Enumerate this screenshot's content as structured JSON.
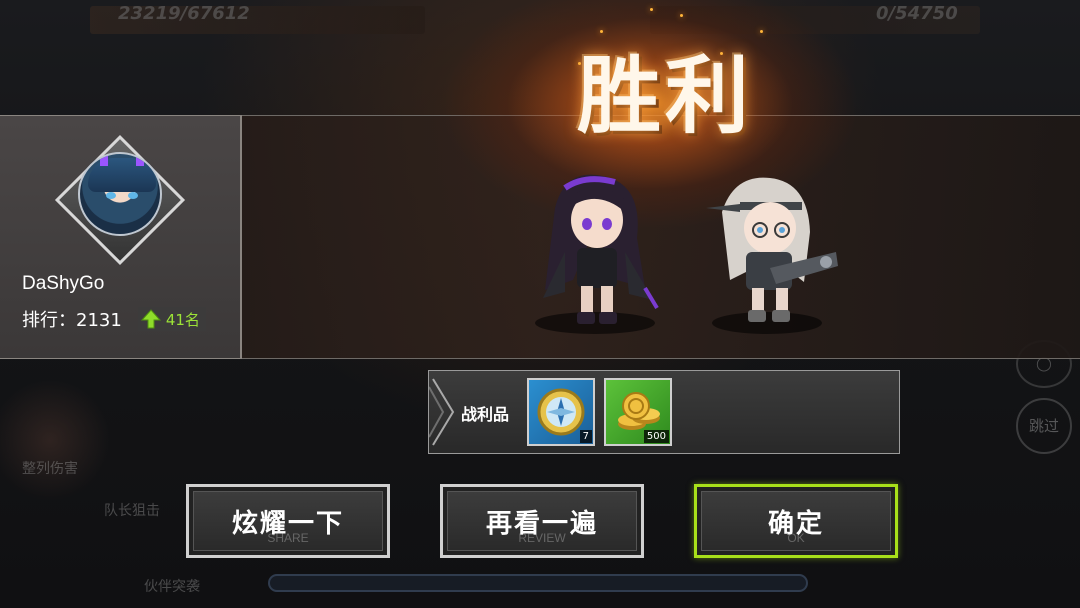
{
  "background": {
    "hp_left": "23219/67612",
    "hp_right": "0/54750",
    "labels": [
      "整列伤害",
      "队长狙击",
      "伙伴突袭"
    ],
    "skip_label": "跳过"
  },
  "victory": {
    "title": "胜利"
  },
  "player": {
    "name": "DaShyGo",
    "rank_label": "排行：2131",
    "rank_change": "41名"
  },
  "loot": {
    "label": "战利品",
    "items": [
      {
        "icon": "compass-medal-icon",
        "count": "7"
      },
      {
        "icon": "gold-coins-icon",
        "count": "500"
      }
    ]
  },
  "buttons": {
    "share": {
      "label": "炫耀一下",
      "sub": "SHARE"
    },
    "review": {
      "label": "再看一遍",
      "sub": "REVIEW"
    },
    "ok": {
      "label": "确定",
      "sub": "OK"
    }
  },
  "colors": {
    "accent": "#a8e01a",
    "rank_up": "#9ce337",
    "glow": "#ff9a20"
  }
}
